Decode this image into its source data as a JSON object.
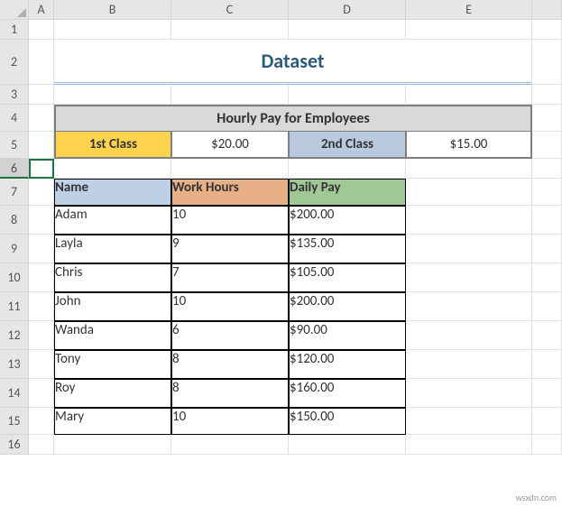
{
  "columns": [
    "A",
    "B",
    "C",
    "D",
    "E"
  ],
  "rows": [
    "1",
    "2",
    "3",
    "4",
    "5",
    "6",
    "7",
    "8",
    "9",
    "10",
    "11",
    "12",
    "13",
    "14",
    "15",
    "16"
  ],
  "title": "Dataset",
  "hourly_pay_header": "Hourly Pay for Employees",
  "class1_label": "1st Class",
  "class1_rate": "$20.00",
  "class2_label": "2nd Class",
  "class2_rate": "$15.00",
  "table_headers": {
    "name": "Name",
    "hours": "Work Hours",
    "pay": "Daily Pay"
  },
  "employees": [
    {
      "name": "Adam",
      "hours": "10",
      "pay": "$200.00"
    },
    {
      "name": "Layla",
      "hours": "9",
      "pay": "$135.00"
    },
    {
      "name": "Chris",
      "hours": "7",
      "pay": "$105.00"
    },
    {
      "name": "John",
      "hours": "10",
      "pay": "$200.00"
    },
    {
      "name": "Wanda",
      "hours": "6",
      "pay": "$90.00"
    },
    {
      "name": "Tony",
      "hours": "8",
      "pay": "$120.00"
    },
    {
      "name": "Roy",
      "hours": "8",
      "pay": "$160.00"
    },
    {
      "name": "Mary",
      "hours": "10",
      "pay": "$150.00"
    }
  ],
  "watermark": "wsxdn.com",
  "selected_row": "6"
}
